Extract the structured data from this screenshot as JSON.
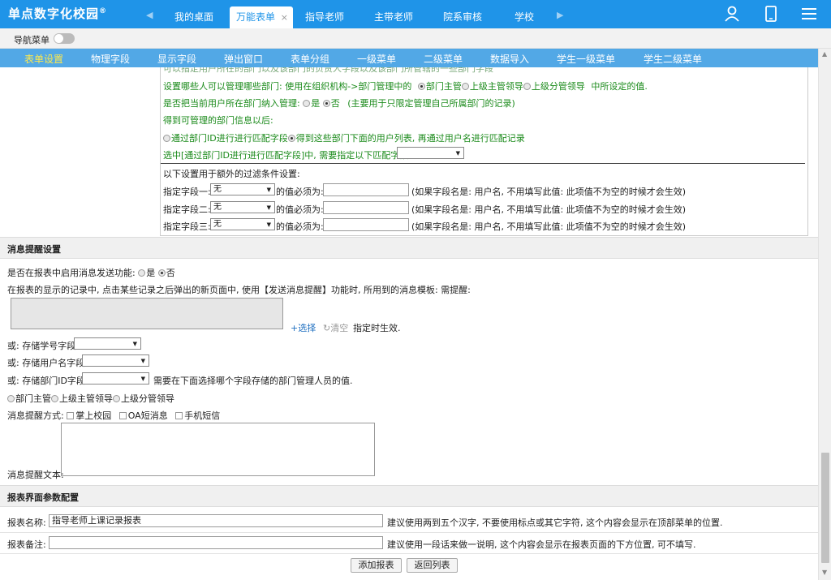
{
  "header": {
    "logo": "单点数字化校园",
    "logo_mark": "®",
    "nav_prev": "◀",
    "nav_next": "▶",
    "tabs": [
      {
        "label": "我的桌面"
      },
      {
        "label": "万能表单",
        "close": "×"
      },
      {
        "label": "指导老师"
      },
      {
        "label": "主带老师"
      },
      {
        "label": "院系审核"
      },
      {
        "label": "学校"
      }
    ],
    "icons": [
      "user-icon",
      "mobile-icon",
      "menu-icon"
    ]
  },
  "togglebar": {
    "label": "导航菜单"
  },
  "subnav": {
    "items": [
      "表单设置",
      "物理字段",
      "显示字段",
      "弹出窗口",
      "表单分组",
      "一级菜单",
      "二级菜单",
      "数据导入",
      "学生一级菜单",
      "学生二级菜单"
    ]
  },
  "top_section": {
    "line0": "可以指定用户所在的部门以及该部门的负责人字段以及该部门所管辖的一些部门字段",
    "manage_dept_prefix": "设置哪些人可以管理哪些部门: 使用在组织机构->部门管理中的",
    "manage_opts": [
      "部门主管",
      "上级主管领导",
      "上级分管领导"
    ],
    "manage_dept_suffix": "中所设定的值.",
    "include_q": "是否把当前用户所在部门纳入管理:",
    "include_yes": "是",
    "include_no": "否",
    "include_note": "(主要用于只限定管理自己所属部门的记录)",
    "after_get": "得到可管理的部门信息以后:",
    "match_opt1": "通过部门ID进行进行匹配字段",
    "match_opt2": "得到这些部门下面的用户列表, 再通过用户名进行匹配记录",
    "match_select_label": "选中[通过部门ID进行进行匹配字段]中, 需要指定以下匹配字段:",
    "extra_title": "以下设置用于额外的过滤条件设置:",
    "filters": [
      {
        "label": "指定字段一:",
        "value": "无",
        "must": "的值必须为:",
        "note": "(如果字段名是: 用户名, 不用填写此值: 此项值不为空的时候才会生效)"
      },
      {
        "label": "指定字段二:",
        "value": "无",
        "must": "的值必须为:",
        "note": "(如果字段名是: 用户名, 不用填写此值: 此项值不为空的时候才会生效)"
      },
      {
        "label": "指定字段三:",
        "value": "无",
        "must": "的值必须为:",
        "note": "(如果字段名是: 用户名, 不用填写此值: 此项值不为空的时候才会生效)"
      }
    ]
  },
  "msg_section": {
    "title": "消息提醒设置",
    "enable_q": "是否在报表中启用消息发送功能:",
    "enable_yes": "是",
    "enable_no": "否",
    "template_desc": "在报表的显示的记录中, 点击某些记录之后弹出的新页面中, 使用【发送消息提醒】功能时, 所用到的消息模板: 需提醒:",
    "select_link": "+选择",
    "clear_link": "清空",
    "effective": "指定时生效.",
    "store_student": "或: 存储学号字段:",
    "store_user": "或: 存储用户名字段:",
    "store_dept": "或: 存储部门ID字段:",
    "dept_note": "需要在下面选择哪个字段存储的部门管理人员的值.",
    "dept_opts": [
      "部门主管",
      "上级主管领导",
      "上级分管领导"
    ],
    "method_label": "消息提醒方式:",
    "methods": [
      "掌上校园",
      "OA短消息",
      "手机短信"
    ],
    "text_label": "消息提醒文本:"
  },
  "report_section": {
    "title": "报表界面参数配置",
    "name_label": "报表名称:",
    "name_value": "指导老师上课记录报表",
    "name_note": "建议使用两到五个汉字, 不要使用标点或其它字符, 这个内容会显示在顶部菜单的位置.",
    "remark_label": "报表备注:",
    "remark_value": "",
    "remark_note": "建议使用一段话来做一说明, 这个内容会显示在报表页面的下方位置, 可不填写.",
    "add_button": "添加报表",
    "back_button": "返回列表"
  }
}
